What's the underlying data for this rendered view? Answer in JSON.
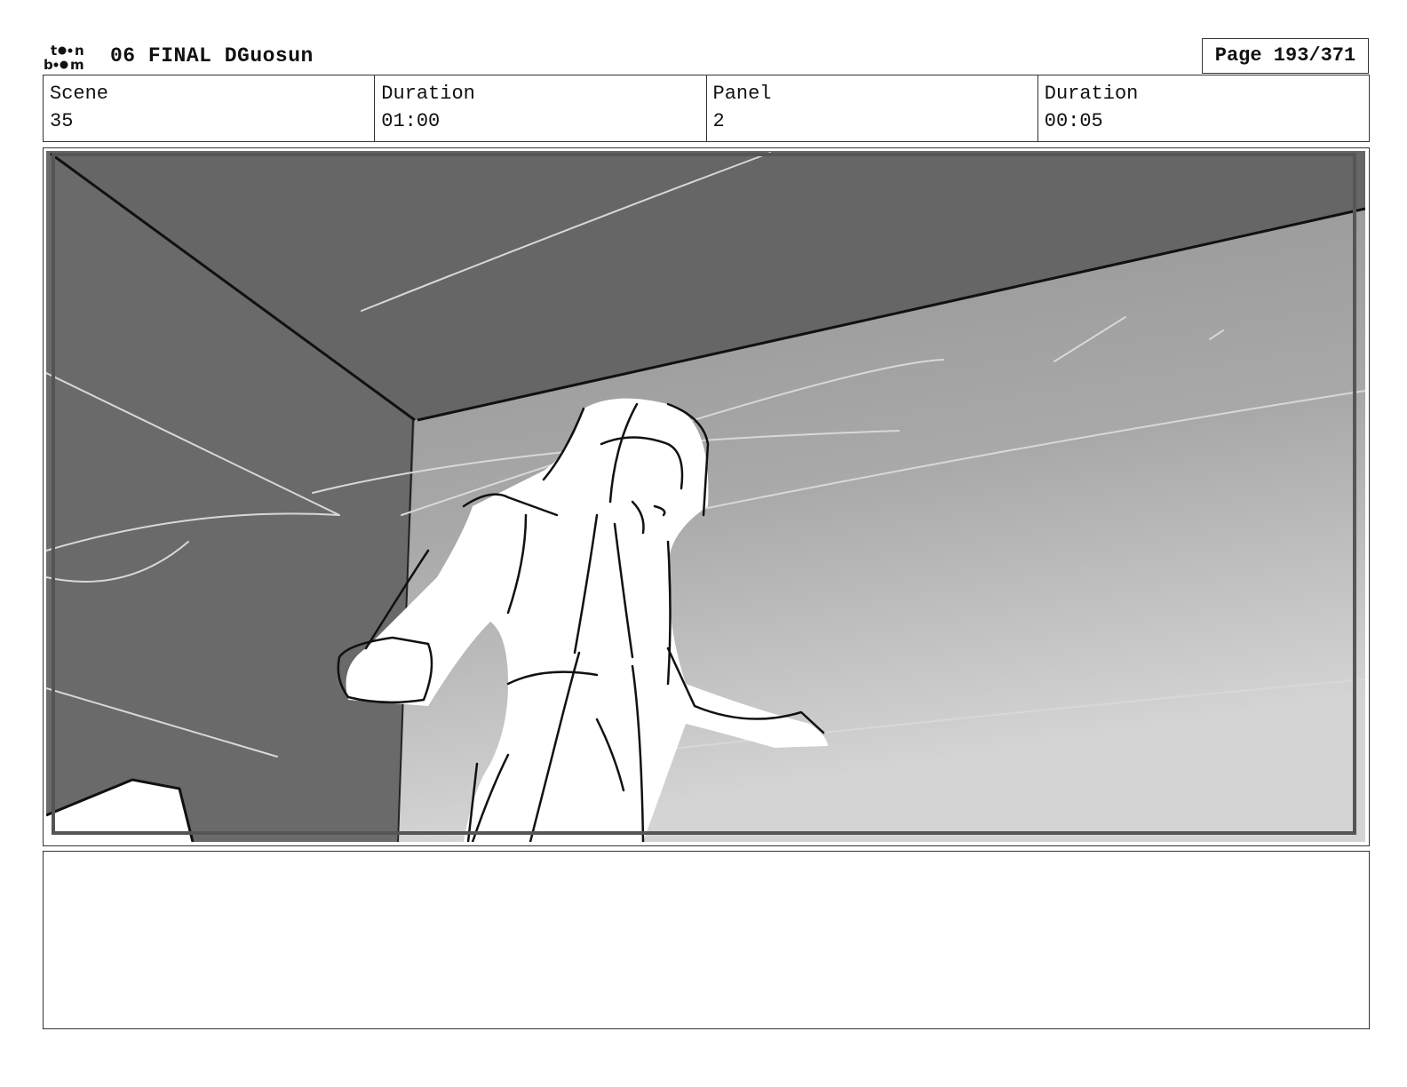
{
  "header": {
    "logo_text": "toon boom",
    "title": "06 FINAL DGuosun",
    "page_label": "Page 193/371"
  },
  "info": {
    "scene_label": "Scene",
    "scene_value": "35",
    "scene_duration_label": "Duration",
    "scene_duration_value": "01:00",
    "panel_label": "Panel",
    "panel_value": "2",
    "panel_duration_label": "Duration",
    "panel_duration_value": "00:05"
  },
  "panel_image": {
    "subject": "storyboard sketch of a girl with long hair and jacket in a grey room, arms outstretched"
  },
  "notes": {
    "text": ""
  }
}
